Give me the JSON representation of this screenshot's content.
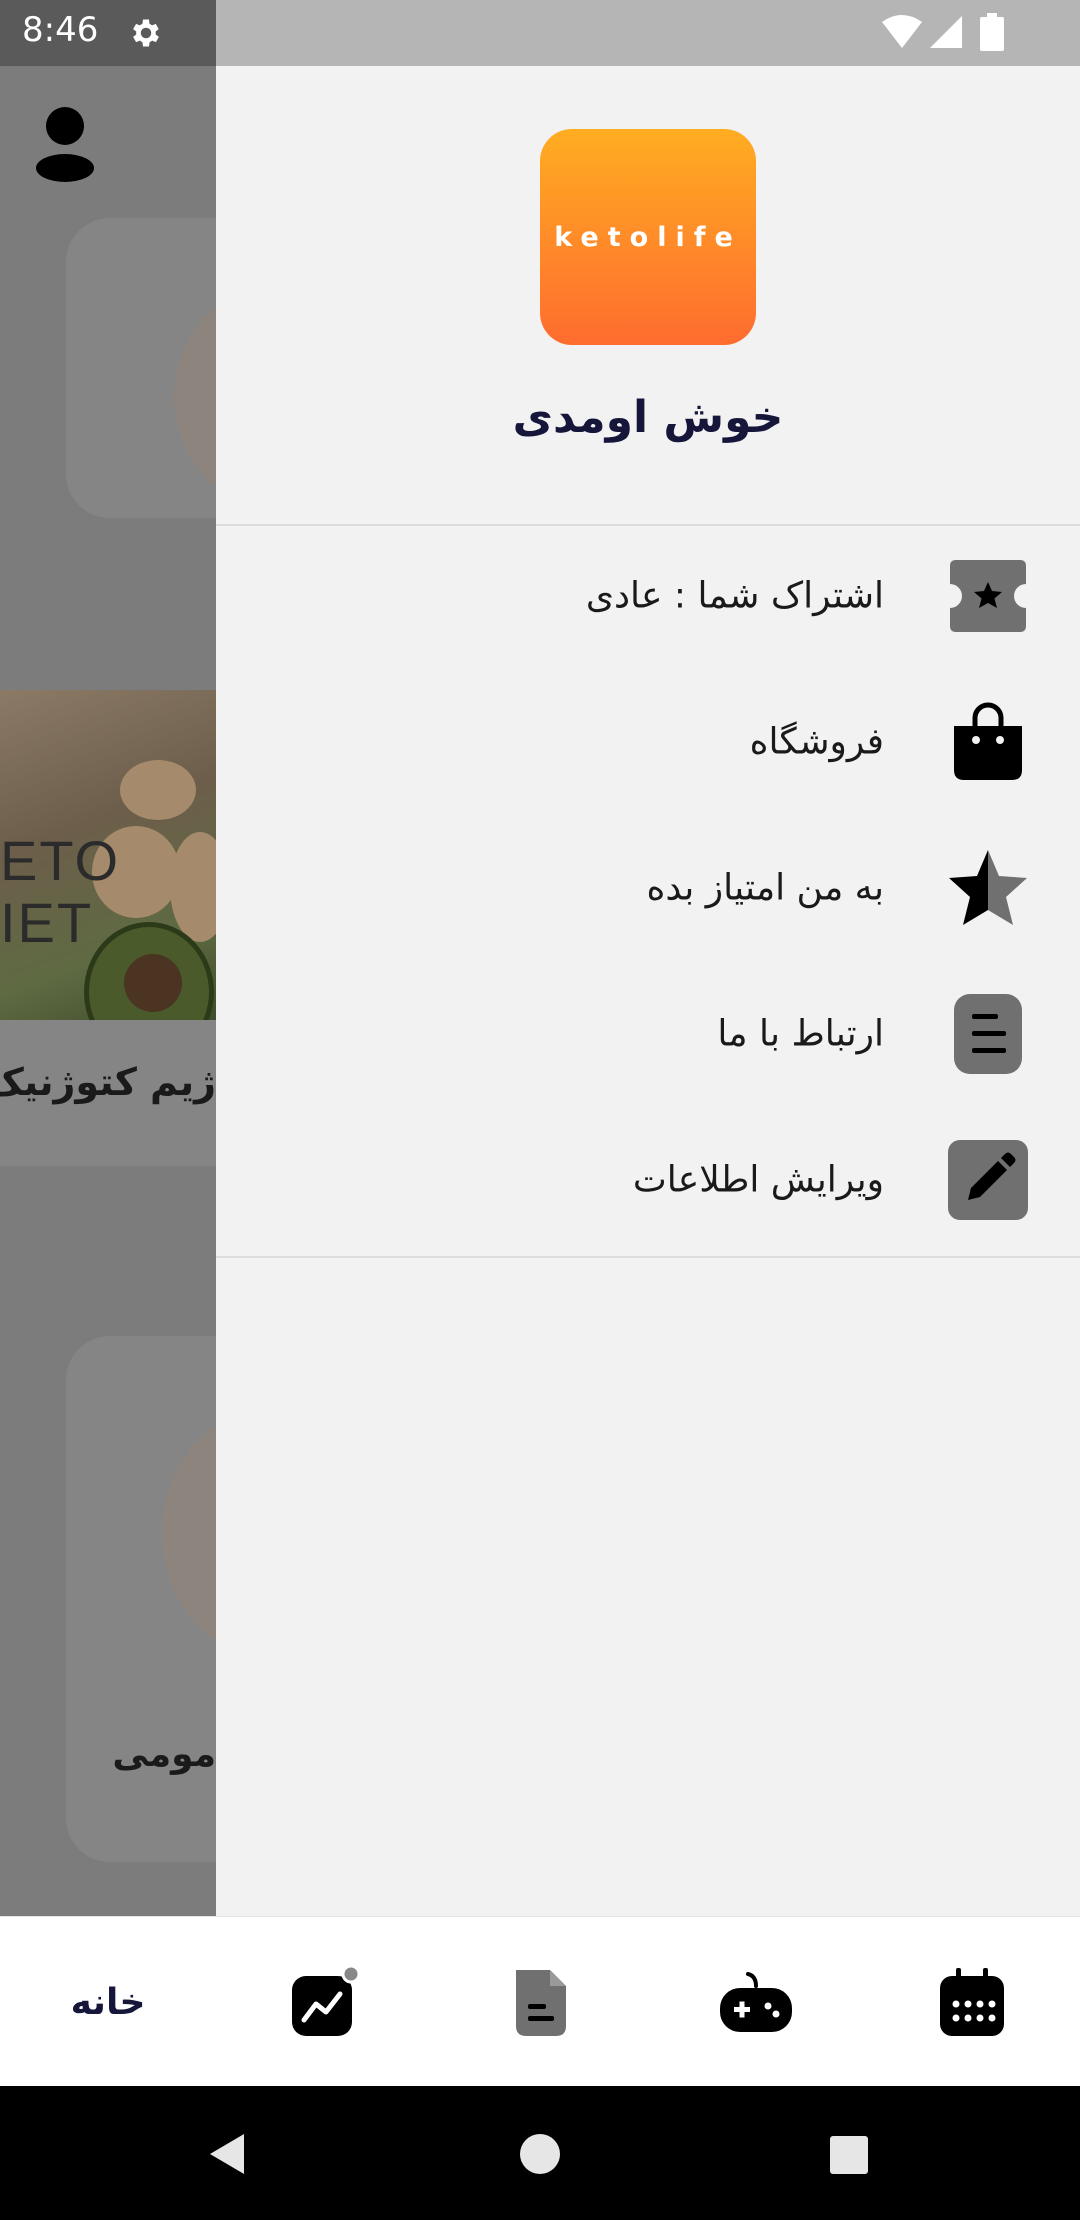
{
  "status_bar": {
    "time": "8:46",
    "icons": [
      "settings-icon",
      "wifi-icon",
      "signal-icon",
      "battery-icon"
    ]
  },
  "background_screen": {
    "card2_title": "ژیم کتوژنیک",
    "card3_title": "مومی",
    "image_text_line1": "ETO",
    "image_text_line2": "IET"
  },
  "drawer": {
    "logo_text": "ketolife",
    "welcome": "خوش اومدی",
    "menu": [
      {
        "label": "اشتراک شما : عادی",
        "icon": "ticket-star-icon"
      },
      {
        "label": "فروشگاه",
        "icon": "shopping-bag-icon"
      },
      {
        "label": "به من امتیاز بده",
        "icon": "half-star-icon"
      },
      {
        "label": "ارتباط با ما",
        "icon": "document-lines-icon"
      },
      {
        "label": "ویرایش اطلاعات",
        "icon": "pencil-icon"
      }
    ]
  },
  "bottom_nav": {
    "home_label": "خانه",
    "items": [
      "home",
      "chart-icon",
      "document-icon",
      "gamepad-icon",
      "calendar-icon"
    ]
  },
  "colors": {
    "logo_top": "#ffad21",
    "logo_bottom": "#ff6c2f",
    "accent": "#ff6c2f",
    "title": "#15163a"
  }
}
